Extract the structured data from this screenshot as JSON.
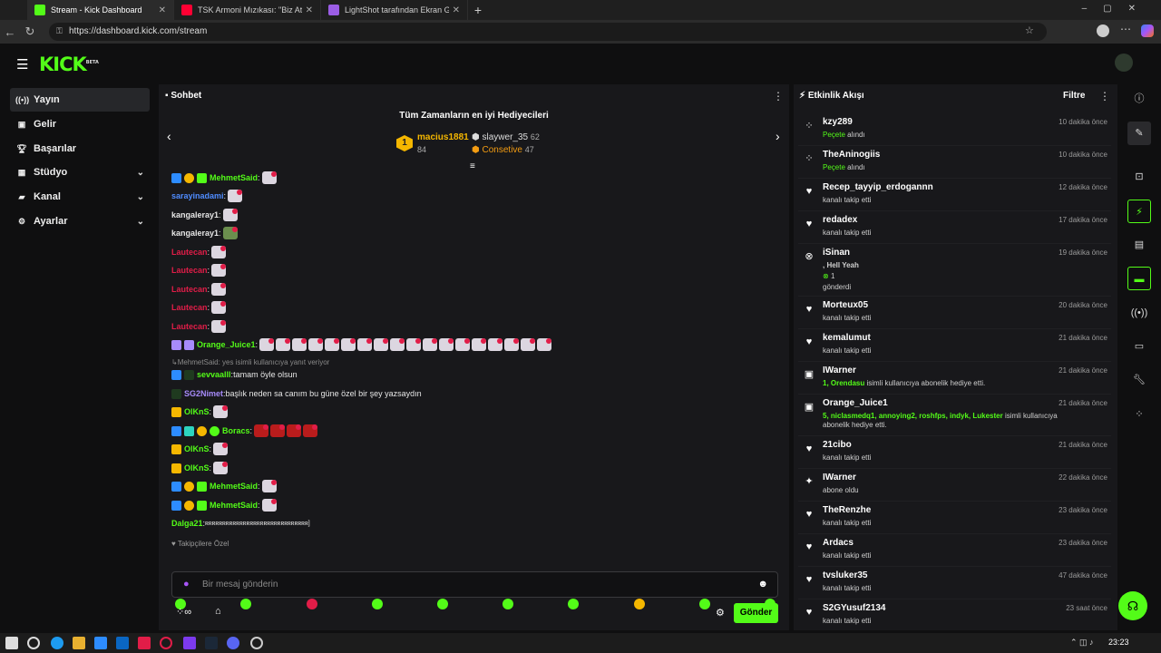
{
  "browser": {
    "tabs": [
      {
        "label": "Stream - Kick Dashboard",
        "color": "#53fc18"
      },
      {
        "label": "TSK Armoni Mızıkası: \"Biz At...",
        "color": "#ff0033"
      },
      {
        "label": "LightShot tarafından Ekran Görün...",
        "color": "#9b5de5"
      }
    ],
    "url": "https://dashboard.kick.com/stream",
    "clock": "23:23"
  },
  "app": {
    "logo": "KICK",
    "logo_badge": "BETA",
    "sidebar": [
      {
        "label": "Yayın",
        "icon": "broadcast-icon"
      },
      {
        "label": "Gelir",
        "icon": "revenue-icon"
      },
      {
        "label": "Başarılar",
        "icon": "trophy-icon"
      },
      {
        "label": "Stüdyo",
        "icon": "studio-icon"
      },
      {
        "label": "Kanal",
        "icon": "channel-icon"
      },
      {
        "label": "Ayarlar",
        "icon": "gear-icon"
      }
    ]
  },
  "chat": {
    "title": "Sohbet",
    "gifters_title": "Tüm Zamanların en iyi Hediyecileri",
    "gifters": [
      {
        "rank": "1",
        "name": "macius1881",
        "count": "84"
      },
      {
        "name": "slaywer_35",
        "count": "62"
      },
      {
        "name": "Consetive",
        "count": "47"
      }
    ],
    "messages": [
      {
        "user": "MehmetSaid",
        "color": "#53fc18",
        "text": ""
      },
      {
        "user": "sarayinadami",
        "color": "#4f8cff",
        "text": ""
      },
      {
        "user": "kangaleray1",
        "color": "#e6e6e6",
        "text": ""
      },
      {
        "user": "kangaleray1",
        "color": "#e6e6e6",
        "text": ""
      },
      {
        "user": "Lautecan",
        "color": "#e11d48",
        "text": ""
      },
      {
        "user": "Lautecan",
        "color": "#e11d48",
        "text": ""
      },
      {
        "user": "Lautecan",
        "color": "#e11d48",
        "text": ""
      },
      {
        "user": "Lautecan",
        "color": "#e11d48",
        "text": ""
      },
      {
        "user": "Lautecan",
        "color": "#e11d48",
        "text": ""
      },
      {
        "user": "Orange_Juice1",
        "color": "#53fc18",
        "text": ""
      },
      {
        "reply": "MehmetSaid: yes isimli kullanıcıya yanıt veriyor"
      },
      {
        "user": "sevvaalll",
        "color": "#53fc18",
        "text": "tamam öyle olsun"
      },
      {
        "user": "SG2Nimet",
        "color": "#a78bfa",
        "text": "başlık neden sa canım bu güne özel bir şey yazsaydın"
      },
      {
        "user": "OlKnS",
        "color": "#53fc18",
        "text": ""
      },
      {
        "user": "Boracs",
        "color": "#53fc18",
        "text": ""
      },
      {
        "user": "OlKnS",
        "color": "#53fc18",
        "text": ""
      },
      {
        "user": "OlKnS",
        "color": "#53fc18",
        "text": ""
      },
      {
        "user": "MehmetSaid",
        "color": "#53fc18",
        "text": ""
      },
      {
        "user": "MehmetSaid",
        "color": "#53fc18",
        "text": ""
      },
      {
        "user": "Dalga21",
        "color": "#53fc18",
        "text": "ʀʀʀʀʀʀʀʀʀʀʀʀʀʀʀʀʀʀʀʀʀʀʀʀʀʀʀʀʀʀ]"
      }
    ],
    "followers_only": "Takipçilere Özel",
    "input_placeholder": "Bir mesaj gönderin",
    "send_label": "Gönder"
  },
  "activity": {
    "title": "Etkinlik Akışı",
    "filter_label": "Filtre",
    "items": [
      {
        "name": "kzy289",
        "time": "10 dakika önce",
        "desc_green": "Peçete",
        "desc": " alındı",
        "icon": "dots-icon"
      },
      {
        "name": "TheAninogiis",
        "time": "10 dakika önce",
        "desc_green": "Peçete",
        "desc": " alındı",
        "icon": "dots-icon"
      },
      {
        "name": "Recep_tayyip_erdogannn",
        "time": "12 dakika önce",
        "desc_green": "",
        "desc": "kanalı takip etti",
        "icon": "heart-icon"
      },
      {
        "name": "redadex",
        "time": "17 dakika önce",
        "desc_green": "",
        "desc": "kanalı takip etti",
        "icon": "heart-icon"
      },
      {
        "name": "iSinan",
        "time": "19 dakika önce",
        "desc_green": ", Hell Yeah",
        "desc": "gönderdi",
        "icon": "kick-coin-icon",
        "count": "1"
      },
      {
        "name": "Morteux05",
        "time": "20 dakika önce",
        "desc_green": "",
        "desc": "kanalı takip etti",
        "icon": "heart-icon"
      },
      {
        "name": "kemalumut",
        "time": "21 dakika önce",
        "desc_green": "",
        "desc": "kanalı takip etti",
        "icon": "heart-icon"
      },
      {
        "name": "IWarner",
        "time": "21 dakika önce",
        "desc_green": "1, Orendasu",
        "desc": " isimli kullanıcıya abonelik hediye etti.",
        "icon": "gift-icon"
      },
      {
        "name": "Orange_Juice1",
        "time": "21 dakika önce",
        "desc_green": "5, niclasmedq1, annoying2, roshfps, indyk, Lukester",
        "desc": " isimli kullanıcıya abonelik hediye etti.",
        "icon": "gift-icon"
      },
      {
        "name": "21cibo",
        "time": "21 dakika önce",
        "desc_green": "",
        "desc": "kanalı takip etti",
        "icon": "heart-icon"
      },
      {
        "name": "IWarner",
        "time": "22 dakika önce",
        "desc_green": "",
        "desc": "abone oldu",
        "icon": "sparkle-icon"
      },
      {
        "name": "TheRenzhe",
        "time": "23 dakika önce",
        "desc_green": "",
        "desc": "kanalı takip etti",
        "icon": "heart-icon"
      },
      {
        "name": "Ardacs",
        "time": "23 dakika önce",
        "desc_green": "",
        "desc": "kanalı takip etti",
        "icon": "heart-icon"
      },
      {
        "name": "tvsluker35",
        "time": "47 dakika önce",
        "desc_green": "",
        "desc": "kanalı takip etti",
        "icon": "heart-icon"
      },
      {
        "name": "S2GYusuf2134",
        "time": "23 saat önce",
        "desc_green": "",
        "desc": "kanalı takip etti",
        "icon": "heart-icon"
      }
    ]
  }
}
